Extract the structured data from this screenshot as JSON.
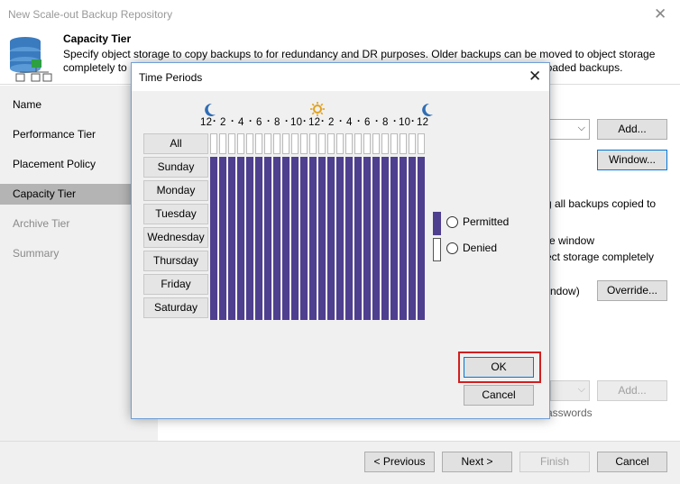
{
  "outer": {
    "title": "New Scale-out Backup Repository",
    "header_title": "Capacity Tier",
    "header_desc_line1": "Specify object storage to copy backups to for redundancy and DR purposes. Older backups can be moved to object storage",
    "header_desc_line2_left": "completely to",
    "header_desc_line2_right": "loaded backups.",
    "sidebar": [
      {
        "label": "Name",
        "state": "normal"
      },
      {
        "label": "Performance Tier",
        "state": "normal"
      },
      {
        "label": "Placement Policy",
        "state": "normal"
      },
      {
        "label": "Capacity Tier",
        "state": "active"
      },
      {
        "label": "Archive Tier",
        "state": "dim"
      },
      {
        "label": "Summary",
        "state": "dim"
      }
    ],
    "add_button": "Add...",
    "window_button": "Window...",
    "text_copy_all": "g all backups copied to",
    "text_window": "re window",
    "text_object_storage": "ect storage completely",
    "text_window2": "ndow)",
    "override_button": "Override...",
    "add_button2": "Add...",
    "text_passwords": "asswords",
    "nav": {
      "previous": "< Previous",
      "next": "Next >",
      "finish": "Finish",
      "cancel": "Cancel"
    }
  },
  "dialog": {
    "title": "Time Periods",
    "hour_labels": [
      "12",
      "2",
      "4",
      "6",
      "8",
      "10",
      "12",
      "2",
      "4",
      "6",
      "8",
      "10",
      "12"
    ],
    "all_label": "All",
    "days": [
      "Sunday",
      "Monday",
      "Tuesday",
      "Wednesday",
      "Thursday",
      "Friday",
      "Saturday"
    ],
    "legend": {
      "permitted": "Permitted",
      "denied": "Denied",
      "permitted_color": "#4f3f8f",
      "denied_color": "#ffffff"
    },
    "ok": "OK",
    "cancel": "Cancel",
    "highlight_color": "#d21e1e",
    "icons": [
      "moon-icon",
      "sun-icon",
      "moon-icon"
    ],
    "schedule_state": "all-permitted"
  }
}
